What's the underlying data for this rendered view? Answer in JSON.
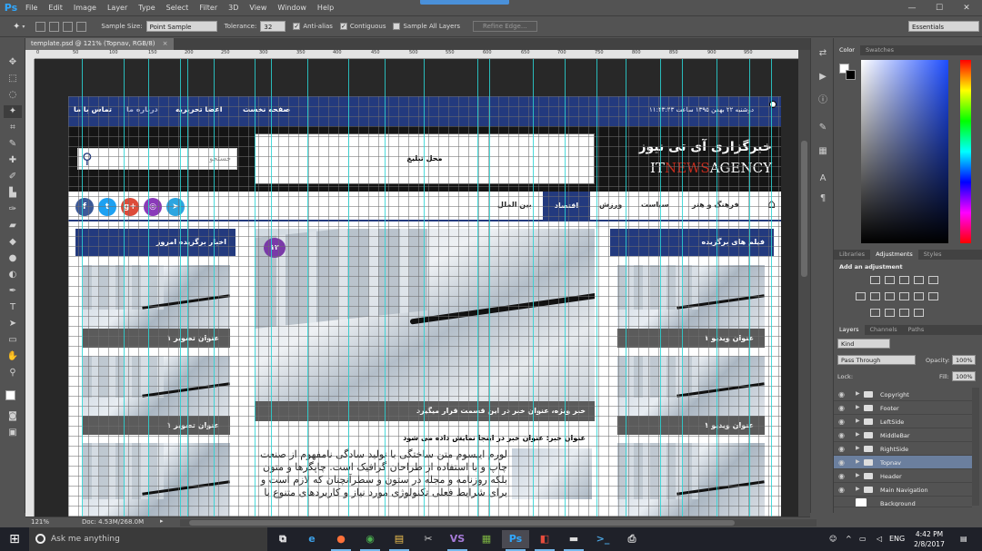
{
  "app": {
    "logo": "Ps",
    "menu": [
      "File",
      "Edit",
      "Image",
      "Layer",
      "Type",
      "Select",
      "Filter",
      "3D",
      "View",
      "Window",
      "Help"
    ]
  },
  "window_controls": {
    "minimize": "—",
    "maximize": "☐",
    "close": "✕"
  },
  "options_bar": {
    "sample_size_label": "Sample Size:",
    "sample_size_value": "Point Sample",
    "tolerance_label": "Tolerance:",
    "tolerance_value": "32",
    "anti_alias": "Anti-alias",
    "contiguous": "Contiguous",
    "sample_all_layers": "Sample All Layers",
    "refine_edge": "Refine Edge...",
    "workspace": "Essentials"
  },
  "document": {
    "tab_title": "template.psd @ 121% (Topnav, RGB/8)",
    "close": "×"
  },
  "ruler": {
    "top_ticks": [
      "0",
      "50",
      "100",
      "150",
      "200",
      "250",
      "300",
      "350",
      "400",
      "450",
      "500",
      "550",
      "600",
      "650",
      "700",
      "750",
      "800",
      "850",
      "900",
      "950"
    ]
  },
  "site": {
    "topnav": {
      "datetime": "دوشنبه ۲۲ بهمن ۱۳۹۵ ساعت ۱۱:۴۳:۴۳",
      "items": [
        "صفحه نخست",
        "اعضا تحریریه",
        "درباره ما",
        "تماس با ما"
      ]
    },
    "header": {
      "search_placeholder": "جستجو",
      "ad_text": "محل تبلیغ",
      "brand_fa": "خبرگزاری آی تی نیوز",
      "brand_en_1": "IT",
      "brand_en_2": "NEWS",
      "brand_en_3": "AGENCY"
    },
    "mainnav": {
      "items": [
        "فرهنگ و هنر",
        "سیاست",
        "اقتصاد",
        "ورزش",
        "بین الملل"
      ],
      "active": "اقتصاد",
      "social": [
        "f",
        "t",
        "g+",
        "◎",
        "➤"
      ]
    },
    "left_col": {
      "title": "اخبار برگزیده امروز",
      "captions": [
        "عنوان تصویر ۱",
        "عنوان تصویر ۱"
      ]
    },
    "right_col": {
      "title": "فیلم های برگزیده",
      "captions": [
        "عنوان ویدیو ۱",
        "عنوان ویدیو ۱"
      ]
    },
    "hero": {
      "badge": "۱۲",
      "caption": "خبر ویژه، عنوان خبر در این قسمت قرار میگیرد"
    },
    "news": {
      "title": "عنوان خبر: عنوان خبر در اینجا نمایش داده می شود",
      "body": "لورم ایپسوم متن ساختگی با تولید سادگی نامفهوم از صنعت چاپ و با استفاده از طراحان گرافیک است. چاپگرها و متون بلکه روزنامه و مجله در ستون و سطرآنچنان که لازم است و برای شرایط فعلی تکنولوژی مورد نیاز و کاربردهای متنوع با"
    }
  },
  "status_bar": {
    "zoom": "121%",
    "doc": "Doc: 4.53M/268.0M",
    "arrow": "▸"
  },
  "panels": {
    "color_tabs": [
      "Color",
      "Swatches"
    ],
    "adj_tabs": [
      "Libraries",
      "Adjustments",
      "Styles"
    ],
    "adj_title": "Add an adjustment",
    "layer_tabs": [
      "Layers",
      "Channels",
      "Paths"
    ],
    "kind": "Kind",
    "blend": "Pass Through",
    "opacity_label": "Opacity:",
    "opacity": "100%",
    "lock_label": "Lock:",
    "fill_label": "Fill:",
    "fill": "100%",
    "layers": [
      "Copyright",
      "Footer",
      "LeftSide",
      "MiddleBar",
      "RightSide",
      "Topnav",
      "Header",
      "Main Navigation",
      "Background"
    ],
    "selected_layer": "Topnav"
  },
  "taskbar": {
    "search": "Ask me anything",
    "apps": [
      "⧉",
      "e",
      "●",
      "◉",
      "▤",
      "✂",
      "VS",
      "▦",
      "Ps",
      "◧",
      "▬",
      ">_",
      "⎙"
    ],
    "tray_lang": "ENG",
    "time": "4:42 PM",
    "date": "2/8/2017"
  },
  "colors": {
    "site_blue": "#233a7e",
    "guide": "#29d3d3",
    "ps_blue": "#31a8ff"
  }
}
